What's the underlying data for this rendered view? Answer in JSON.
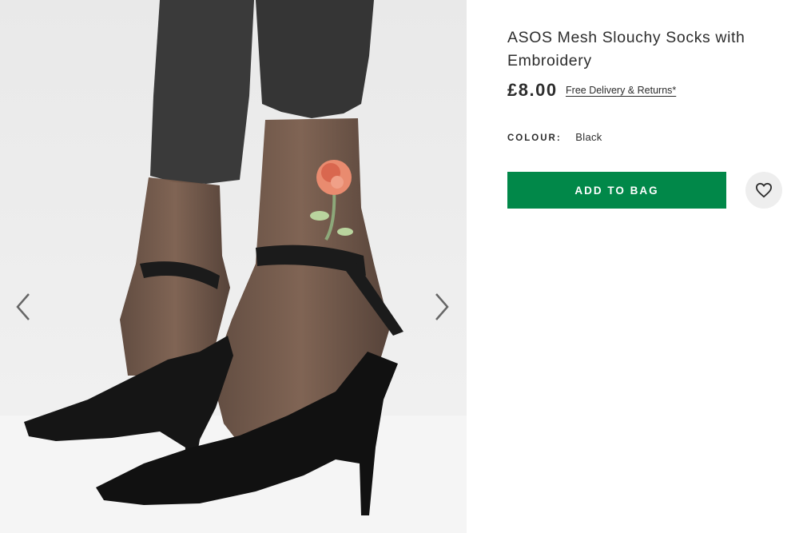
{
  "product": {
    "title": "ASOS Mesh Slouchy Socks with Embroidery",
    "price": "£8.00",
    "delivery_link": "Free Delivery & Returns*",
    "colour_label": "COLOUR:",
    "colour_value": "Black"
  },
  "actions": {
    "add_to_bag": "ADD TO BAG"
  },
  "icons": {
    "prev": "chevron-left-icon",
    "next": "chevron-right-icon",
    "save": "heart-icon"
  },
  "colors": {
    "add_to_bag_bg": "#018849",
    "save_bg": "#eeeeee",
    "text": "#2d2d2d"
  }
}
